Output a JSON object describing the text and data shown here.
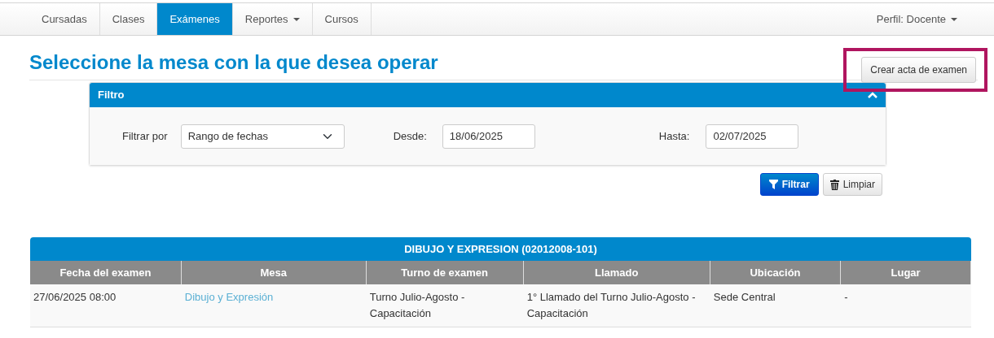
{
  "nav": {
    "items": [
      {
        "label": "Cursadas",
        "selected": false,
        "dropdown": false
      },
      {
        "label": "Clases",
        "selected": false,
        "dropdown": false
      },
      {
        "label": "Exámenes",
        "selected": true,
        "dropdown": false
      },
      {
        "label": "Reportes",
        "selected": false,
        "dropdown": true
      },
      {
        "label": "Cursos",
        "selected": false,
        "dropdown": false
      }
    ],
    "profile": {
      "label": "Perfil: Docente",
      "dropdown": true
    }
  },
  "page_title": "Seleccione la mesa con la que desea operar",
  "create_button": {
    "label": "Crear acta de examen",
    "highlighted": true
  },
  "filter": {
    "title": "Filtro",
    "expanded": true,
    "filter_by": {
      "label": "Filtrar por",
      "value": "Rango de fechas"
    },
    "from": {
      "label": "Desde:",
      "value": "18/06/2025"
    },
    "to": {
      "label": "Hasta:",
      "value": "02/07/2025"
    },
    "buttons": [
      {
        "label": "Filtrar",
        "kind": "primary"
      },
      {
        "label": "Limpiar",
        "kind": "secondary"
      }
    ]
  },
  "table": {
    "title": "DIBUJO Y EXPRESION (02012008-101)",
    "columns": [
      "Fecha del examen",
      "Mesa",
      "Turno de examen",
      "Llamado",
      "Ubicación",
      "Lugar"
    ],
    "rows": [
      [
        {
          "text": "27/06/2025 08:00",
          "kind": "text"
        },
        {
          "text": "Dibujo y Expresión",
          "kind": "link"
        },
        {
          "text": "Turno Julio-Agosto - Capacitación",
          "kind": "text"
        },
        {
          "text": "1° Llamado del Turno Julio-Agosto - Capacitación",
          "kind": "text"
        },
        {
          "text": "Sede Central",
          "kind": "text"
        },
        {
          "text": "-",
          "kind": "text"
        }
      ]
    ]
  }
}
